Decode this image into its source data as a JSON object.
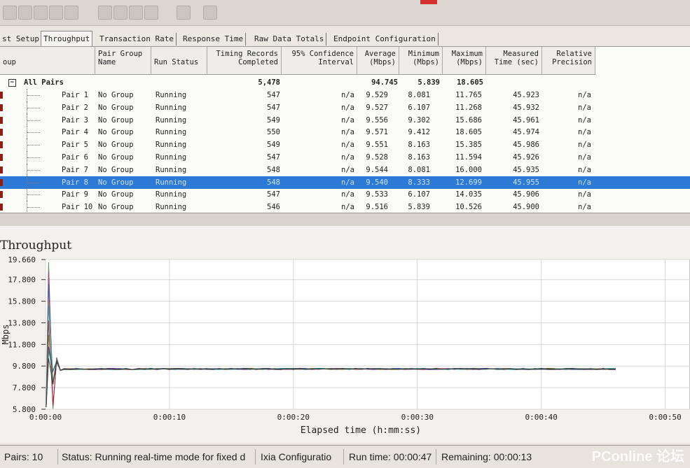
{
  "tabs": [
    "st Setup",
    "Throughput",
    "Transaction Rate",
    "Response Time",
    "Raw Data Totals",
    "Endpoint Configuration"
  ],
  "active_tab": 1,
  "columns": {
    "group": "oup",
    "pair_group_name": "Pair Group\nName",
    "run_status": "Run Status",
    "timing_records": "Timing Records\nCompleted",
    "confidence": "95% Confidence\nInterval",
    "average": "Average\n(Mbps)",
    "minimum": "Minimum\n(Mbps)",
    "maximum": "Maximum\n(Mbps)",
    "measured_time": "Measured\nTime (sec)",
    "relative_precision": "Relative\nPrecision"
  },
  "summary": {
    "label": "All Pairs",
    "records": "5,478",
    "average": "94.745",
    "minimum": "5.839",
    "maximum": "18.605"
  },
  "rows": [
    {
      "pair": "Pair 1",
      "group": "No Group",
      "status": "Running",
      "records": "547",
      "ci": "n/a",
      "avg": "9.529",
      "min": "8.081",
      "max": "11.765",
      "time": "45.923",
      "prec": "n/a"
    },
    {
      "pair": "Pair 2",
      "group": "No Group",
      "status": "Running",
      "records": "547",
      "ci": "n/a",
      "avg": "9.527",
      "min": "6.107",
      "max": "11.268",
      "time": "45.932",
      "prec": "n/a"
    },
    {
      "pair": "Pair 3",
      "group": "No Group",
      "status": "Running",
      "records": "549",
      "ci": "n/a",
      "avg": "9.556",
      "min": "9.302",
      "max": "15.686",
      "time": "45.961",
      "prec": "n/a"
    },
    {
      "pair": "Pair 4",
      "group": "No Group",
      "status": "Running",
      "records": "550",
      "ci": "n/a",
      "avg": "9.571",
      "min": "9.412",
      "max": "18.605",
      "time": "45.974",
      "prec": "n/a"
    },
    {
      "pair": "Pair 5",
      "group": "No Group",
      "status": "Running",
      "records": "549",
      "ci": "n/a",
      "avg": "9.551",
      "min": "8.163",
      "max": "15.385",
      "time": "45.986",
      "prec": "n/a"
    },
    {
      "pair": "Pair 6",
      "group": "No Group",
      "status": "Running",
      "records": "547",
      "ci": "n/a",
      "avg": "9.528",
      "min": "8.163",
      "max": "11.594",
      "time": "45.926",
      "prec": "n/a"
    },
    {
      "pair": "Pair 7",
      "group": "No Group",
      "status": "Running",
      "records": "548",
      "ci": "n/a",
      "avg": "9.544",
      "min": "8.081",
      "max": "16.000",
      "time": "45.935",
      "prec": "n/a"
    },
    {
      "pair": "Pair 8",
      "group": "No Group",
      "status": "Running",
      "records": "548",
      "ci": "n/a",
      "avg": "9.540",
      "min": "8.333",
      "max": "12.699",
      "time": "45.955",
      "prec": "n/a",
      "selected": true
    },
    {
      "pair": "Pair 9",
      "group": "No Group",
      "status": "Running",
      "records": "547",
      "ci": "n/a",
      "avg": "9.533",
      "min": "6.107",
      "max": "14.035",
      "time": "45.906",
      "prec": "n/a"
    },
    {
      "pair": "Pair 10",
      "group": "No Group",
      "status": "Running",
      "records": "546",
      "ci": "n/a",
      "avg": "9.516",
      "min": "5.839",
      "max": "10.526",
      "time": "45.900",
      "prec": "n/a"
    }
  ],
  "chart_data": {
    "type": "line",
    "title": "Throughput",
    "xlabel": "Elapsed time (h:mm:ss)",
    "ylabel": "Mbps",
    "ylim": [
      5.8,
      19.66
    ],
    "yticks": [
      "19.660",
      "17.800",
      "15.800",
      "13.800",
      "11.800",
      "9.800",
      "7.800",
      "5.800"
    ],
    "ytick_values": [
      19.66,
      17.8,
      15.8,
      13.8,
      11.8,
      9.8,
      7.8,
      5.8
    ],
    "xlim": [
      0,
      52
    ],
    "xticks": [
      "0:00:00",
      "0:00:10",
      "0:00:20",
      "0:00:30",
      "0:00:40",
      "0:00:50"
    ],
    "xtick_values": [
      0,
      10,
      20,
      30,
      40,
      50
    ],
    "grid": true,
    "steady_value": 9.53,
    "end_time": 46,
    "series_colors": [
      "#2a8a3a",
      "#c03090",
      "#3050c0",
      "#d08020",
      "#20a0b0",
      "#a02020",
      "#707020",
      "#5020a0",
      "#208060",
      "#303030"
    ]
  },
  "status": {
    "pairs": "Pairs: 10",
    "message": "Status: Running real-time mode for fixed d",
    "config": "Ixia Configuratio",
    "run_time": "Run time: 00:00:47",
    "remaining": "Remaining: 00:00:13"
  },
  "watermark": "PConline 论坛"
}
